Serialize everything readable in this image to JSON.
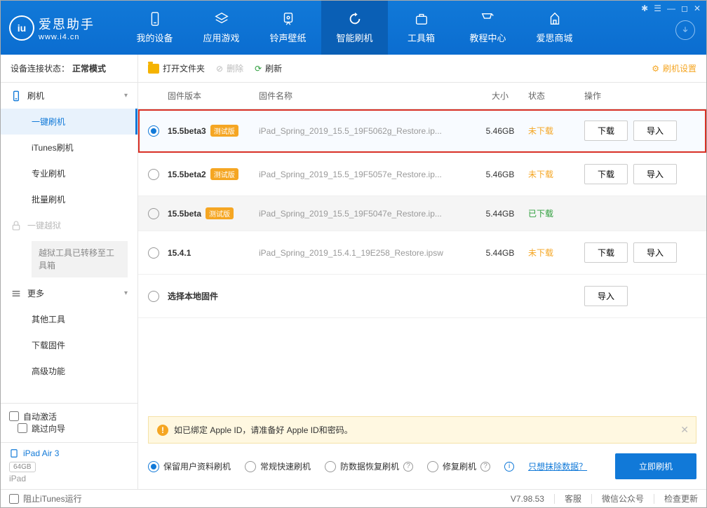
{
  "app": {
    "name": "爱思助手",
    "url": "www.i4.cn"
  },
  "win_controls": [
    "✱",
    "☰",
    "—",
    "◻",
    "✕"
  ],
  "top_tabs": [
    {
      "label": "我的设备"
    },
    {
      "label": "应用游戏"
    },
    {
      "label": "铃声壁纸"
    },
    {
      "label": "智能刷机",
      "active": true
    },
    {
      "label": "工具箱"
    },
    {
      "label": "教程中心"
    },
    {
      "label": "爱思商城"
    }
  ],
  "side": {
    "status_label": "设备连接状态：",
    "status_value": "正常模式",
    "groups": {
      "flash": {
        "title": "刷机",
        "items": [
          "一键刷机",
          "iTunes刷机",
          "专业刷机",
          "批量刷机"
        ],
        "active": 0
      },
      "jailbreak": {
        "title": "一键越狱",
        "note": "越狱工具已转移至工具箱"
      },
      "more": {
        "title": "更多",
        "items": [
          "其他工具",
          "下载固件",
          "高级功能"
        ]
      }
    },
    "auto_activate": "自动激活",
    "skip_guide": "跳过向导",
    "device_name": "iPad Air 3",
    "device_storage": "64GB",
    "device_type": "iPad"
  },
  "toolbar": {
    "open": "打开文件夹",
    "del": "删除",
    "refresh": "刷新",
    "settings": "刷机设置"
  },
  "columns": {
    "ver": "固件版本",
    "name": "固件名称",
    "size": "大小",
    "stat": "状态",
    "ops": "操作"
  },
  "rows": [
    {
      "sel": true,
      "hl": true,
      "ver": "15.5beta3",
      "beta": "测试版",
      "name": "iPad_Spring_2019_15.5_19F5062g_Restore.ip...",
      "size": "5.46GB",
      "stat": "未下载",
      "stat_cls": "stat-orange",
      "ops": [
        "下载",
        "导入"
      ]
    },
    {
      "ver": "15.5beta2",
      "beta": "测试版",
      "name": "iPad_Spring_2019_15.5_19F5057e_Restore.ip...",
      "size": "5.46GB",
      "stat": "未下载",
      "stat_cls": "stat-orange",
      "ops": [
        "下载",
        "导入"
      ]
    },
    {
      "ver": "15.5beta",
      "beta": "测试版",
      "name": "iPad_Spring_2019_15.5_19F5047e_Restore.ip...",
      "size": "5.44GB",
      "stat": "已下载",
      "stat_cls": "stat-green",
      "ops": [],
      "shaded": true
    },
    {
      "ver": "15.4.1",
      "name": "iPad_Spring_2019_15.4.1_19E258_Restore.ipsw",
      "size": "5.44GB",
      "stat": "未下载",
      "stat_cls": "stat-orange",
      "ops": [
        "下载",
        "导入"
      ]
    },
    {
      "local": true,
      "ver": "选择本地固件",
      "ops": [
        "导入"
      ]
    }
  ],
  "notice": "如已绑定 Apple ID，请准备好 Apple ID和密码。",
  "modes": [
    {
      "label": "保留用户资料刷机",
      "on": true
    },
    {
      "label": "常规快速刷机"
    },
    {
      "label": "防数据恢复刷机",
      "help": true
    },
    {
      "label": "修复刷机",
      "help": true
    }
  ],
  "erase_link": "只想抹除数据？",
  "flash_now": "立即刷机",
  "status": {
    "block_itunes": "阻止iTunes运行",
    "version": "V7.98.53",
    "support": "客服",
    "wechat": "微信公众号",
    "update": "检查更新"
  }
}
